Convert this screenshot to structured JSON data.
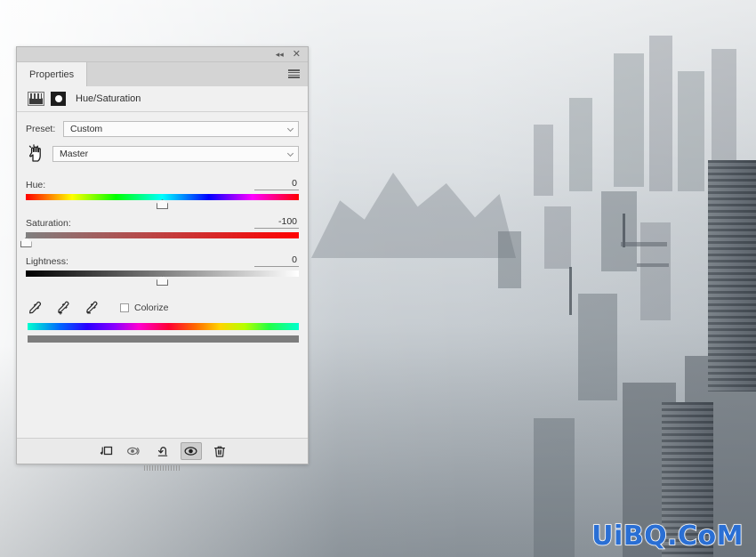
{
  "window": {
    "collapse_label": "◂◂",
    "close_label": "✕",
    "menu_icon": "hamburger-menu-icon"
  },
  "panel": {
    "tab_label": "Properties",
    "title": "Hue/Saturation",
    "preset_icon": "adjustment-preset-icon",
    "mask_icon": "layer-mask-icon"
  },
  "preset": {
    "label": "Preset:",
    "value": "Custom"
  },
  "channel": {
    "value": "Master",
    "cursor_icon": "pointing-hand-cursor"
  },
  "sliders": [
    {
      "label": "Hue:",
      "value": "0",
      "percent": 50,
      "track": "hue"
    },
    {
      "label": "Saturation:",
      "value": "-100",
      "percent": 0,
      "track": "saturation"
    },
    {
      "label": "Lightness:",
      "value": "0",
      "percent": 50,
      "track": "lightness"
    }
  ],
  "tools": {
    "eyedropper": "eyedropper-icon",
    "eyedropper_add": "eyedropper-add-icon",
    "eyedropper_subtract": "eyedropper-subtract-icon",
    "colorize_label": "Colorize",
    "colorize_checked": false
  },
  "spectrum": {
    "hue_bar": "hue-spectrum-bar",
    "range_bar": "adjustment-range-bar"
  },
  "footer": {
    "buttons": [
      {
        "name": "clip-to-layer-icon",
        "title": "Clip to layer"
      },
      {
        "name": "view-previous-state-icon",
        "title": "View previous state"
      },
      {
        "name": "reset-icon",
        "title": "Reset to default"
      },
      {
        "name": "toggle-visibility-icon",
        "title": "Toggle layer visibility",
        "active": true
      },
      {
        "name": "delete-icon",
        "title": "Delete adjustment layer"
      }
    ]
  },
  "watermark": {
    "text": "UiBQ.CoM",
    "color": "#2a6fd4"
  },
  "colors": {
    "panel_bg": "#f0f0f0",
    "tabbar_bg": "#d4d4d4",
    "text": "#3c3c3c",
    "accent": "#2a6fd4"
  }
}
